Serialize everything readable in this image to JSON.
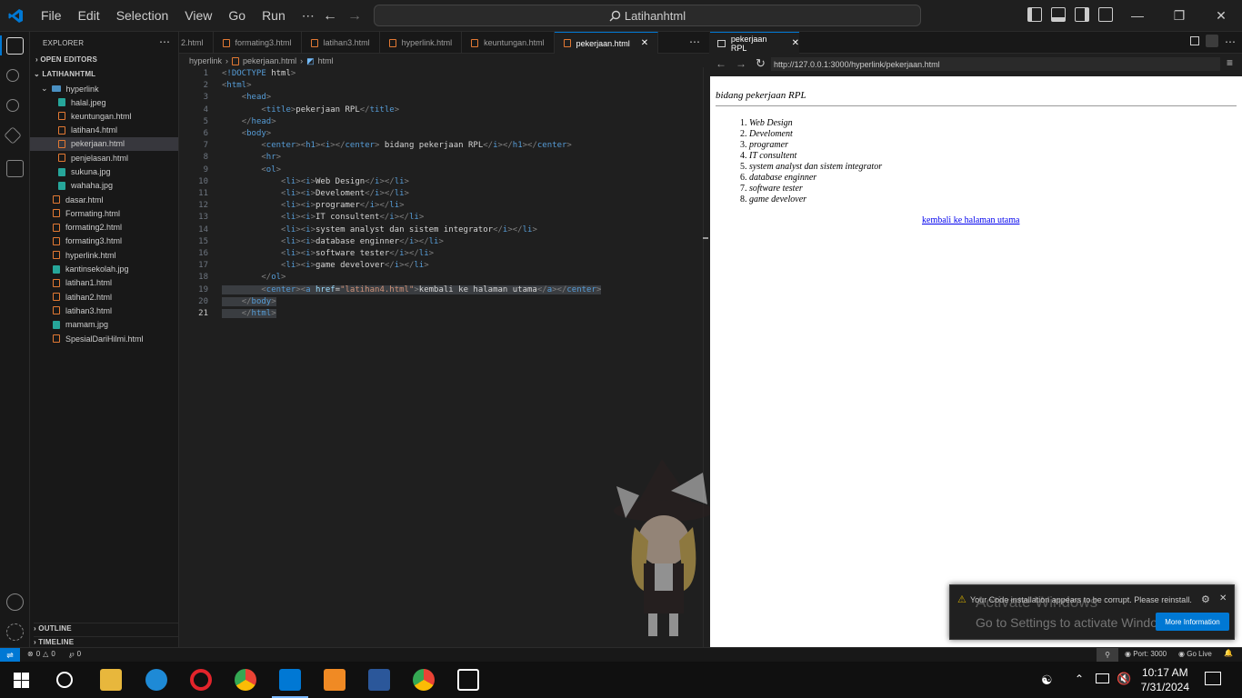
{
  "titlebar": {
    "menu": [
      "File",
      "Edit",
      "Selection",
      "View",
      "Go",
      "Run",
      "⋯"
    ],
    "search_text": "Latihanhtml"
  },
  "sidebar": {
    "title": "EXPLORER",
    "open_editors": "OPEN EDITORS",
    "workspace": "LATIHANHTML",
    "folder": "hyperlink",
    "folder_files": [
      {
        "name": "halal.jpeg",
        "type": "img"
      },
      {
        "name": "keuntungan.html",
        "type": "html"
      },
      {
        "name": "latihan4.html",
        "type": "html"
      },
      {
        "name": "pekerjaan.html",
        "type": "html",
        "active": true
      },
      {
        "name": "penjelasan.html",
        "type": "html"
      },
      {
        "name": "sukuna.jpg",
        "type": "img"
      },
      {
        "name": "wahaha.jpg",
        "type": "img"
      }
    ],
    "root_files": [
      {
        "name": "dasar.html",
        "type": "html"
      },
      {
        "name": "Formating.html",
        "type": "html"
      },
      {
        "name": "formating2.html",
        "type": "html"
      },
      {
        "name": "formating3.html",
        "type": "html"
      },
      {
        "name": "hyperlink.html",
        "type": "html"
      },
      {
        "name": "kantinsekolah.jpg",
        "type": "img"
      },
      {
        "name": "latihan1.html",
        "type": "html"
      },
      {
        "name": "latihan2.html",
        "type": "html"
      },
      {
        "name": "latihan3.html",
        "type": "html"
      },
      {
        "name": "mamam.jpg",
        "type": "img"
      },
      {
        "name": "SpesialDariHilmi.html",
        "type": "html"
      }
    ],
    "outline": "OUTLINE",
    "timeline": "TIMELINE"
  },
  "tabs": [
    "2.html",
    "formating3.html",
    "latihan3.html",
    "hyperlink.html",
    "keuntungan.html",
    "pekerjaan.html"
  ],
  "active_tab": "pekerjaan.html",
  "breadcrumb": [
    "hyperlink",
    "pekerjaan.html",
    "html"
  ],
  "code_lines": [
    "<!DOCTYPE html>",
    "<html>",
    "    <head>",
    "        <title>pekerjaan RPL</title>",
    "    </head>",
    "    <body>",
    "        <center><h1><i></center> bidang pekerjaan RPL</i></h1></center>",
    "        <hr>",
    "        <ol>",
    "            <li><i>Web Design</i></li>",
    "            <li><i>Develoment</i></li>",
    "            <li><i>programer</i></li>",
    "            <li><i>IT consultent</i></li>",
    "            <li><i>system analyst dan sistem integrator</i></li>",
    "            <li><i>database enginner</i></li>",
    "            <li><i>software tester</i></li>",
    "            <li><i>game develover</i></li>",
    "        </ol>",
    "        <center><a href=\"latihan4.html\">kembali ke halaman utama</a></center>",
    "    </body>",
    "    </html>"
  ],
  "preview": {
    "tab_title": "pekerjaan RPL",
    "url": "http://127.0.0.1:3000/hyperlink/pekerjaan.html",
    "heading": "bidang pekerjaan RPL",
    "items": [
      "Web Design",
      "Develoment",
      "programer",
      "IT consultent",
      "system analyst dan sistem integrator",
      "database enginner",
      "software tester",
      "game develover"
    ],
    "link_text": "kembali ke halaman utama"
  },
  "notification": {
    "message": "Your Code installation appears to be corrupt. Please reinstall.",
    "button": "More Information",
    "watermark_title": "Activate Windows",
    "watermark_sub": "Go to Settings to activate Windows."
  },
  "statusbar": {
    "errors": "0",
    "warnings": "0",
    "ports": "0",
    "port_label": "Port: 3000",
    "golive": "Go Live"
  },
  "taskbar": {
    "time": "10:17 AM",
    "date": "7/31/2024"
  }
}
